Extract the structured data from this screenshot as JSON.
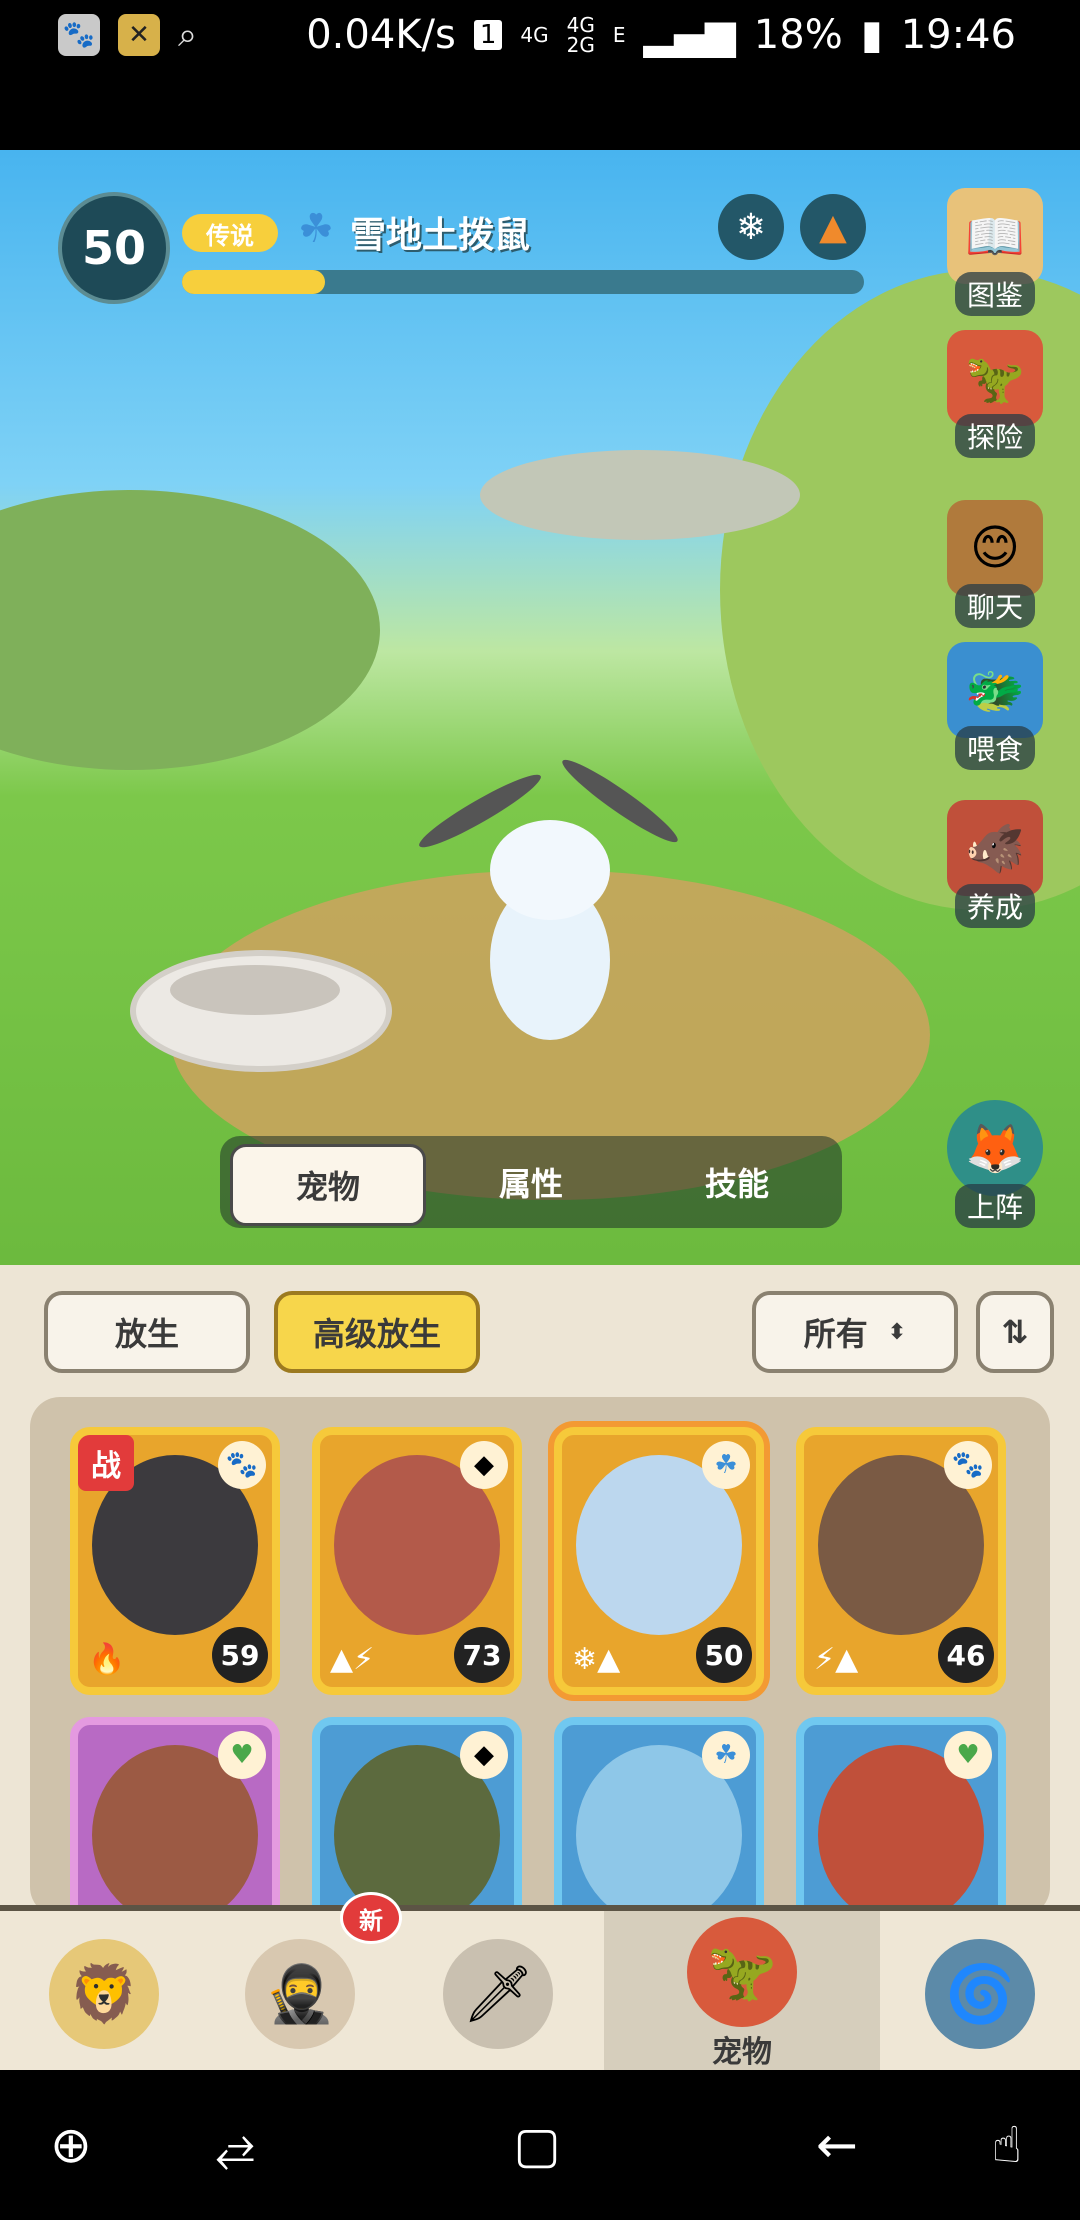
{
  "status_bar": {
    "speed": "0.04K/s",
    "sim_slot": "1",
    "net1": "4G",
    "net2_top": "4G",
    "net2_bottom": "2G",
    "net3": "E",
    "battery": "18%",
    "time": "19:46"
  },
  "pet": {
    "level": "50",
    "rarity": "传说",
    "name": "雪地土拨鼠",
    "xp_fraction": 0.21,
    "elements": [
      "snowflake-icon",
      "earth-icon"
    ]
  },
  "side_menu": [
    {
      "label": "图鉴",
      "icon": "book-icon"
    },
    {
      "label": "探险",
      "icon": "adventure-icon"
    },
    {
      "label": "聊天",
      "icon": "chat-icon"
    },
    {
      "label": "喂食",
      "icon": "feed-icon"
    },
    {
      "label": "养成",
      "icon": "train-icon"
    },
    {
      "label": "上阵",
      "icon": "deploy-icon"
    }
  ],
  "tabs": [
    {
      "label": "宠物",
      "active": true
    },
    {
      "label": "属性",
      "active": false
    },
    {
      "label": "技能",
      "active": false
    }
  ],
  "panel": {
    "release_label": "放生",
    "advanced_release_label": "高级放生",
    "filter_label": "所有",
    "sort_icon": "sort-icon"
  },
  "cards": [
    {
      "level": "59",
      "war": "战",
      "style": "gold"
    },
    {
      "level": "73",
      "style": "gold"
    },
    {
      "level": "50",
      "style": "gold",
      "selected": true
    },
    {
      "level": "46",
      "style": "gold"
    },
    {
      "style": "purple"
    },
    {
      "style": "blue"
    },
    {
      "style": "blue"
    },
    {
      "style": "blue"
    }
  ],
  "bottom_nav": [
    {
      "label": "",
      "icon": "caveman-icon"
    },
    {
      "label": "",
      "icon": "hero-icon",
      "badge": "新"
    },
    {
      "label": "",
      "icon": "weapon-icon"
    },
    {
      "label": "宠物",
      "icon": "pet-icon",
      "active": true
    },
    {
      "label": "",
      "icon": "portal-icon"
    }
  ],
  "colors": {
    "sky": "#48b4ef",
    "grass": "#6cba3e",
    "gold": "#f7cf3c",
    "panel": "#ede5d5",
    "hud_dark": "#1e4a57"
  }
}
